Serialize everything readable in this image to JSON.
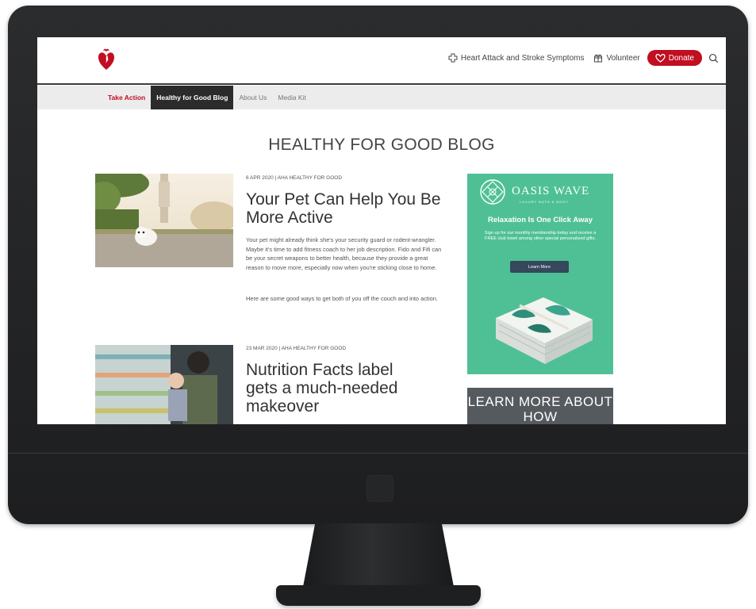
{
  "header": {
    "utility_links": [
      {
        "label": "Heart Attack and Stroke Symptoms",
        "icon": "medical-cross-icon"
      },
      {
        "label": "Volunteer",
        "icon": "volunteer-icon"
      }
    ],
    "donate_label": "Donate",
    "brand_color": "#c10e21"
  },
  "subnav": {
    "items": [
      {
        "label": "Take Action"
      },
      {
        "label": "Healthy for Good Blog"
      },
      {
        "label": "About Us"
      },
      {
        "label": "Media Kit"
      }
    ],
    "active_index": 1
  },
  "page": {
    "title": "HEALTHY FOR GOOD BLOG"
  },
  "posts": [
    {
      "meta": "6 APR 2020 | AHA HEALTHY FOR GOOD",
      "title": "Your Pet Can Help You Be More Active",
      "paragraphs": [
        "Your pet might already think she's your security guard or rodent-wrangler. Maybe it's time to add fitness coach to her job description. Fido and Fifi can be your secret weapons to better health, because they provide a great reason to move more, especially now when you're sticking close to home.",
        "Here are some good ways to get both of you off the couch and into action."
      ]
    },
    {
      "meta": "23 MAR 2020 | AHA HEALTHY FOR GOOD",
      "title": "Nutrition Facts label gets a much-needed makeover"
    }
  ],
  "ad": {
    "brand": "OASIS WAVE",
    "tagline": "LUXURY BATH & BODY",
    "headline": "Relaxation Is One Click Away",
    "copy": "Sign up for our monthly membership today and receive a FREE club towel among other special personalized gifts.",
    "button_label": "Learn More",
    "background_color": "#4fc096"
  },
  "learn_box": {
    "text": "LEARN MORE ABOUT HOW"
  }
}
